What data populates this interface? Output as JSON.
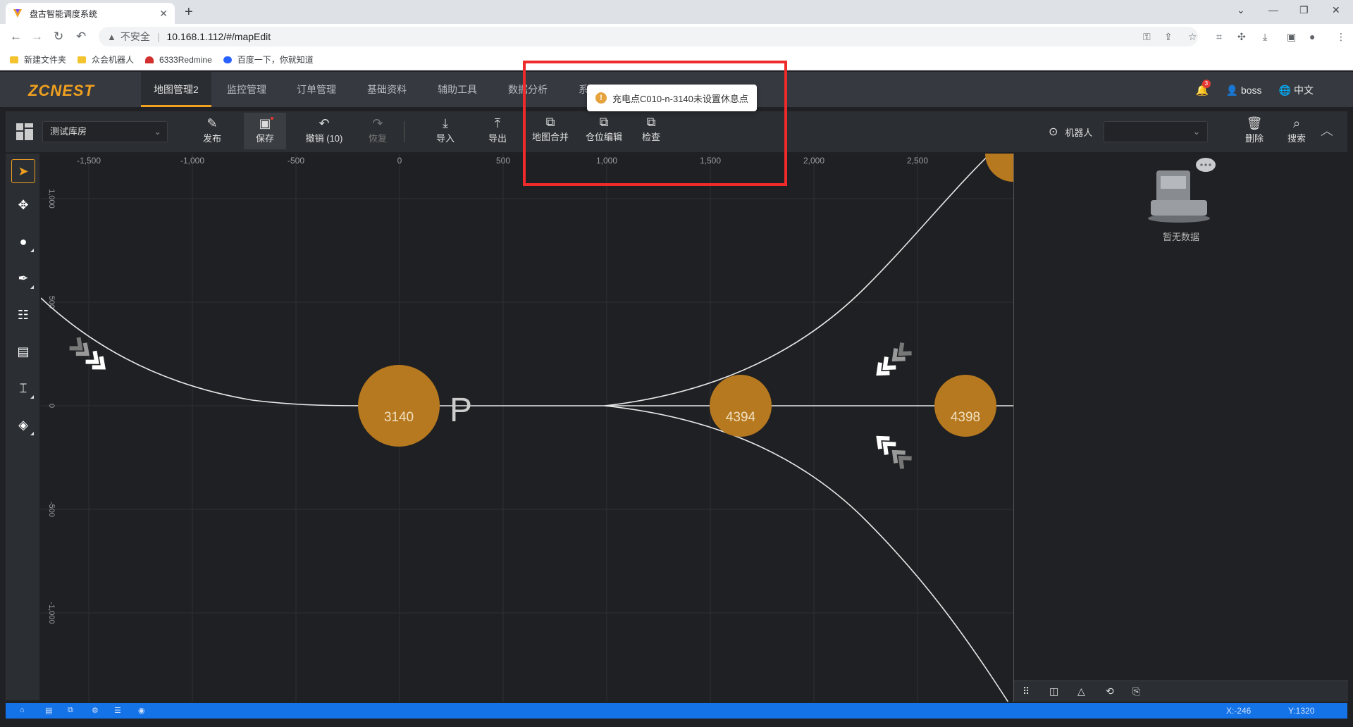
{
  "browser": {
    "tab_title": "盘古智能调度系统",
    "url_security": "不安全",
    "url": "10.168.1.112/#/mapEdit",
    "bookmarks": [
      {
        "label": "新建文件夹",
        "color": "#f4c430"
      },
      {
        "label": "众会机器人",
        "color": "#f4c430"
      },
      {
        "label": "6333Redmine",
        "color": "#d32f2f"
      },
      {
        "label": "百度一下，你就知道",
        "color": "#2962ff"
      }
    ]
  },
  "app": {
    "logo": "ZCNEST",
    "nav": [
      {
        "label": "地图管理2",
        "active": true
      },
      {
        "label": "监控管理"
      },
      {
        "label": "订单管理"
      },
      {
        "label": "基础资料"
      },
      {
        "label": "辅助工具"
      },
      {
        "label": "数据分析"
      },
      {
        "label": "系"
      }
    ],
    "notification_count": "3",
    "user": "boss",
    "language": "中文"
  },
  "toolbar": {
    "warehouse": "测试库房",
    "buttons": {
      "publish": "发布",
      "save": "保存",
      "undo": "撤销 (10)",
      "redo": "恢复",
      "import": "导入",
      "export": "导出",
      "merge": "地图合并",
      "slot_edit": "仓位编辑",
      "check": "检查",
      "delete": "删除",
      "search": "搜索"
    },
    "robot_label": "机器人"
  },
  "toast": {
    "message": "充电点C010-n-3140未设置休息点"
  },
  "canvas": {
    "x_ticks": [
      "-1,500",
      "-1,000",
      "-500",
      "0",
      "500",
      "1,000",
      "1,500",
      "2,000",
      "2,500"
    ],
    "y_ticks": [
      "1,000",
      "500",
      "0",
      "-500",
      "-1,000"
    ],
    "nodes": [
      {
        "id": "3140",
        "label": "3140"
      },
      {
        "id": "4394",
        "label": "4394"
      },
      {
        "id": "4398",
        "label": "4398"
      }
    ],
    "parking_label": "P"
  },
  "right_panel": {
    "empty_text": "暂无数据"
  },
  "status": {
    "x": "X:-246",
    "y": "Y:1320"
  }
}
